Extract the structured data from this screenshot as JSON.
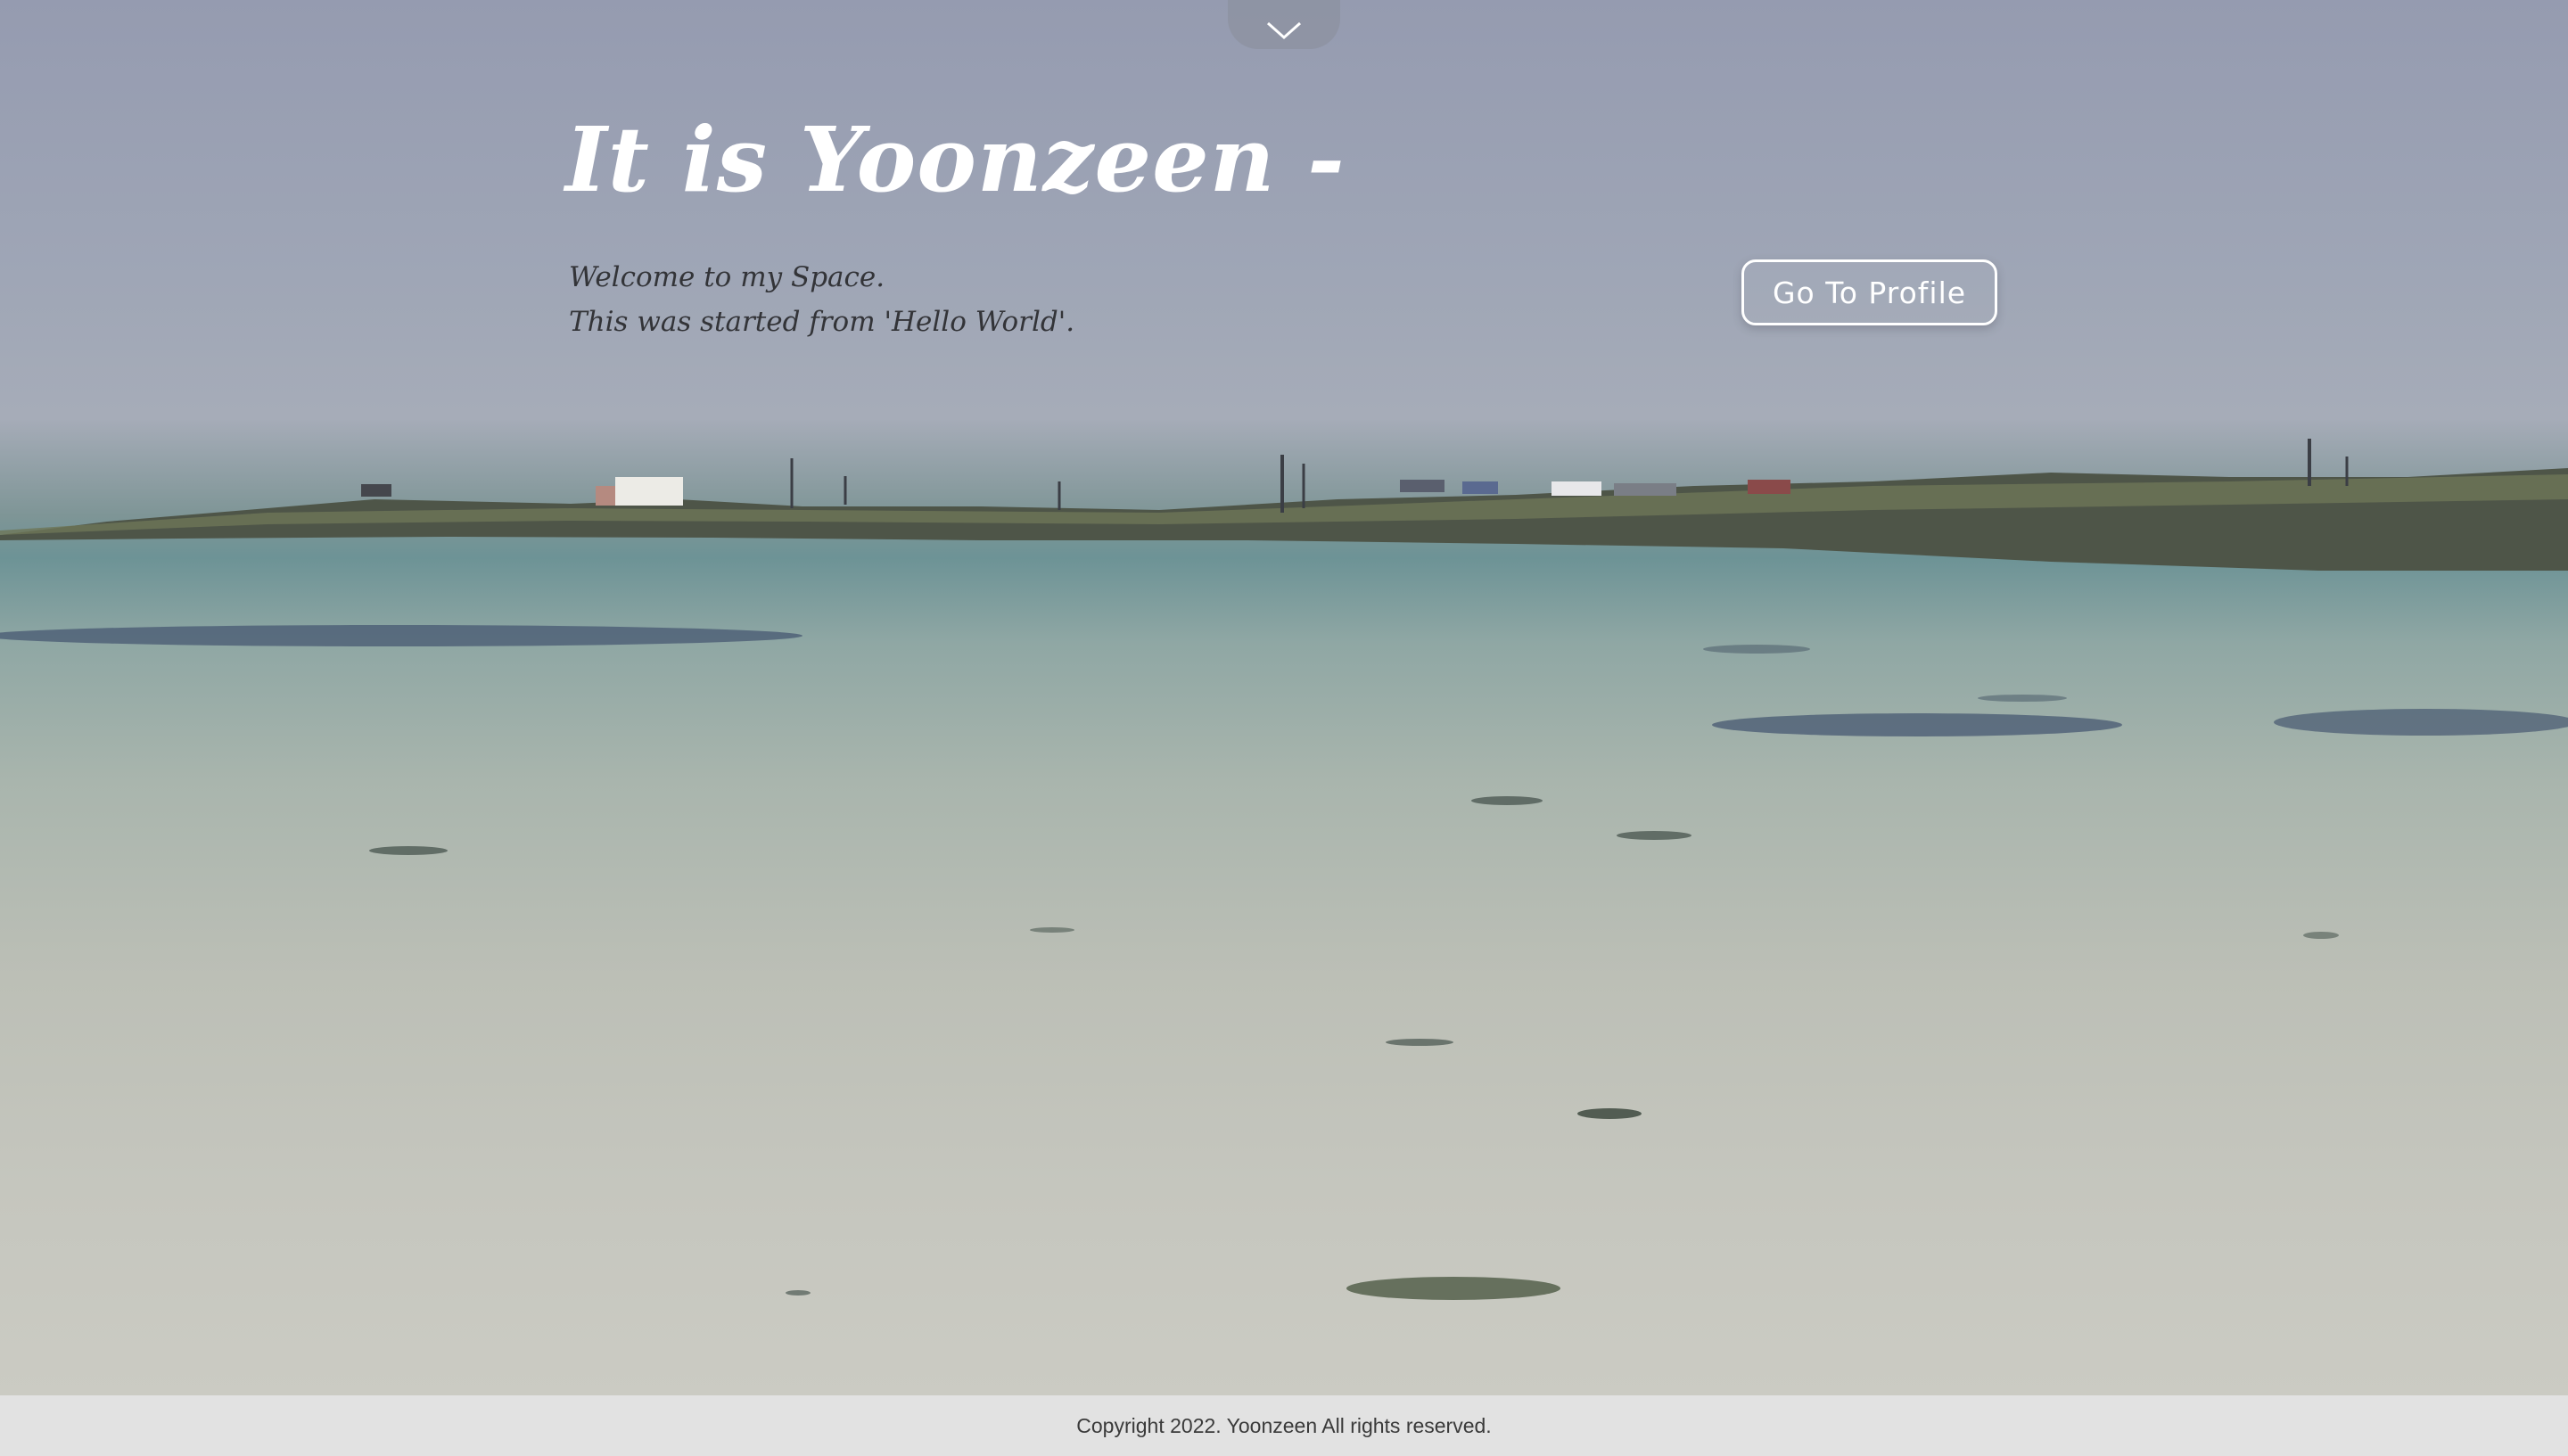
{
  "hero": {
    "title": "It is Yoonzeen -",
    "subtitle_lines": [
      "Welcome to my Space.",
      "This was started from 'Hello World'."
    ],
    "profile_button_label": "Go To Profile",
    "scroll_icon": "chevron-down-icon"
  },
  "footer": {
    "copyright": "Copyright 2022. Yoonzeen All rights reserved."
  },
  "colors": {
    "sky": "#9fa6b6",
    "sea": "#6d9396",
    "sand": "#c5c6be",
    "footer_bg": "#e2e2e2",
    "text_dark": "#333438",
    "text_light": "#ffffff"
  }
}
